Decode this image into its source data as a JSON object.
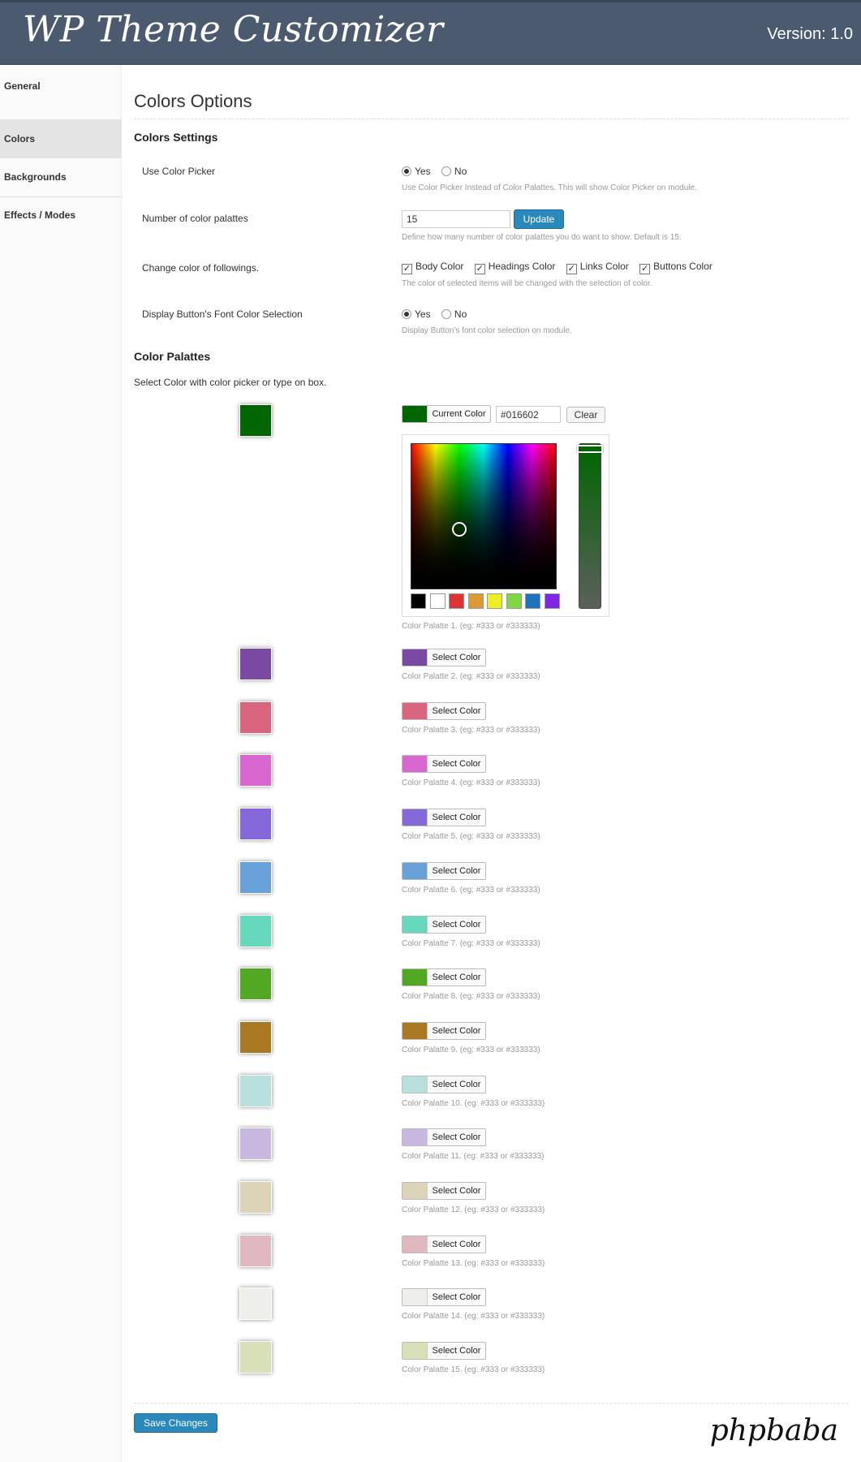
{
  "header": {
    "brand": "WP Theme Customizer",
    "version": "Version: 1.0"
  },
  "sidebar": {
    "items": [
      {
        "label": "General"
      },
      {
        "label": "Colors"
      },
      {
        "label": "Backgrounds"
      },
      {
        "label": "Effects / Modes"
      }
    ]
  },
  "page_title": "Colors Options",
  "colors_settings": {
    "title": "Colors Settings",
    "use_picker": {
      "label": "Use Color Picker",
      "yes": "Yes",
      "no": "No",
      "selected": "Yes",
      "desc": "Use Color Picker Instead of Color Palattes. This will show Color Picker on module."
    },
    "num_palattes": {
      "label": "Number of color palattes",
      "value": "15",
      "button": "Update",
      "desc": "Define how many number of color palattes you do want to show. Default is 15."
    },
    "change_color": {
      "label": "Change color of followings.",
      "options": [
        "Body Color",
        "Headings Color",
        "Links Color",
        "Buttons Color"
      ],
      "desc": "The color of selected items will be changed with the selection of color."
    },
    "btn_font": {
      "label": "Display Button's Font Color Selection",
      "yes": "Yes",
      "no": "No",
      "selected": "Yes",
      "desc": "Display Button's font color selection on module."
    }
  },
  "palattes": {
    "title": "Color Palattes",
    "intro": "Select Color with color picker or type on box.",
    "current_label": "Current Color",
    "current_hex": "#016602",
    "clear_label": "Clear",
    "select_label": "Select Color",
    "picker_mini_colors": [
      "#000000",
      "#ffffff",
      "#dd3333",
      "#dd9933",
      "#eeee22",
      "#81d742",
      "#1e73be",
      "#8224e3"
    ],
    "items": [
      {
        "color": "#016602",
        "desc": "Color Palatte 1. (eg: #333 or #333333)"
      },
      {
        "color": "#7a4aa3",
        "desc": "Color Palatte 2. (eg: #333 or #333333)"
      },
      {
        "color": "#d9657f",
        "desc": "Color Palatte 3. (eg: #333 or #333333)"
      },
      {
        "color": "#d868d0",
        "desc": "Color Palatte 4. (eg: #333 or #333333)"
      },
      {
        "color": "#8468d8",
        "desc": "Color Palatte 5. (eg: #333 or #333333)"
      },
      {
        "color": "#68a0d8",
        "desc": "Color Palatte 6. (eg: #333 or #333333)"
      },
      {
        "color": "#68d8bc",
        "desc": "Color Palatte 7. (eg: #333 or #333333)"
      },
      {
        "color": "#52a822",
        "desc": "Color Palatte 8. (eg: #333 or #333333)"
      },
      {
        "color": "#a87822",
        "desc": "Color Palatte 9. (eg: #333 or #333333)"
      },
      {
        "color": "#b8e0dc",
        "desc": "Color Palatte 10. (eg: #333 or #333333)"
      },
      {
        "color": "#c8b8e0",
        "desc": "Color Palatte 11. (eg: #333 or #333333)"
      },
      {
        "color": "#dcd4b8",
        "desc": "Color Palatte 12. (eg: #333 or #333333)"
      },
      {
        "color": "#e0b8c0",
        "desc": "Color Palatte 13. (eg: #333 or #333333)"
      },
      {
        "color": "#eeeeea",
        "desc": "Color Palatte 14. (eg: #333 or #333333)"
      },
      {
        "color": "#d8e0b8",
        "desc": "Color Palatte 15. (eg: #333 or #333333)"
      }
    ]
  },
  "save_label": "Save Changes",
  "footer_logo": "phpbaba"
}
